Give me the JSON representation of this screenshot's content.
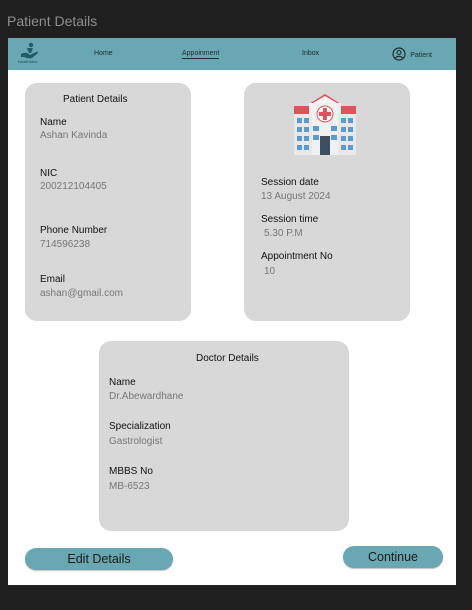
{
  "window": {
    "title": "Patient Details"
  },
  "nav": {
    "logo_text": "HealthMed",
    "home": "Home",
    "appointment": "Appoinment",
    "inbox": "Inbox",
    "user": "Patient"
  },
  "patient": {
    "title": "Patient Details",
    "name_label": "Name",
    "name": "Ashan Kavinda",
    "nic_label": "NIC",
    "nic": "200212104405",
    "phone_label": "Phone Number",
    "phone": "714596238",
    "email_label": "Email",
    "email": "ashan@gmail.com"
  },
  "session": {
    "date_label": "Session date",
    "date": "13 August 2024",
    "time_label": "Session time",
    "time": "5.30 P.M",
    "appt_label": "Appointment No",
    "appt": "10"
  },
  "doctor": {
    "title": "Doctor Details",
    "name_label": "Name",
    "name": "Dr.Abewardhane",
    "spec_label": "Specialization",
    "spec": "Gastrologist",
    "mbbs_label": "MBBS No",
    "mbbs": "MB-6523"
  },
  "actions": {
    "edit": "Edit Details",
    "continue": "Continue"
  },
  "colors": {
    "accent": "#69a7b3",
    "card": "#d8d8d8",
    "background": "#1f1f1f"
  },
  "icons": {
    "logo": "health-hand-icon",
    "user": "user-circle-icon",
    "hospital": "hospital-building-icon"
  }
}
